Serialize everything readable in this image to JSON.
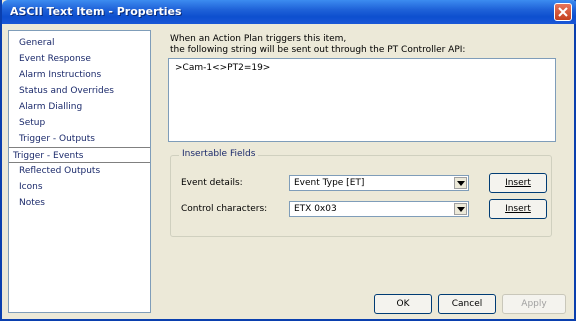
{
  "window": {
    "title": "ASCII Text Item - Properties"
  },
  "sidebar": {
    "items": [
      {
        "label": "General"
      },
      {
        "label": "Event Response"
      },
      {
        "label": "Alarm Instructions"
      },
      {
        "label": "Status and Overrides"
      },
      {
        "label": "Alarm Dialling"
      },
      {
        "label": "Setup"
      },
      {
        "label": "Trigger - Outputs"
      },
      {
        "label": "Trigger - Events",
        "selected": true
      },
      {
        "label": "Reflected Outputs"
      },
      {
        "label": "Icons"
      },
      {
        "label": "Notes"
      }
    ]
  },
  "main": {
    "description_line1": "When an Action Plan triggers this item,",
    "description_line2": "the following string will be sent out through the PT Controller API:",
    "string_value": ">Cam-1<>PT2=19>",
    "insertable_fields": {
      "title": "Insertable Fields",
      "event_details_label": "Event details:",
      "event_details_value": "Event Type [ET]",
      "control_characters_label": "Control characters:",
      "control_characters_value": "ETX 0x03",
      "insert_label": "Insert",
      "insert2_label": "Insert"
    }
  },
  "footer": {
    "ok_label": "OK",
    "cancel_label": "Cancel",
    "apply_label": "Apply"
  }
}
